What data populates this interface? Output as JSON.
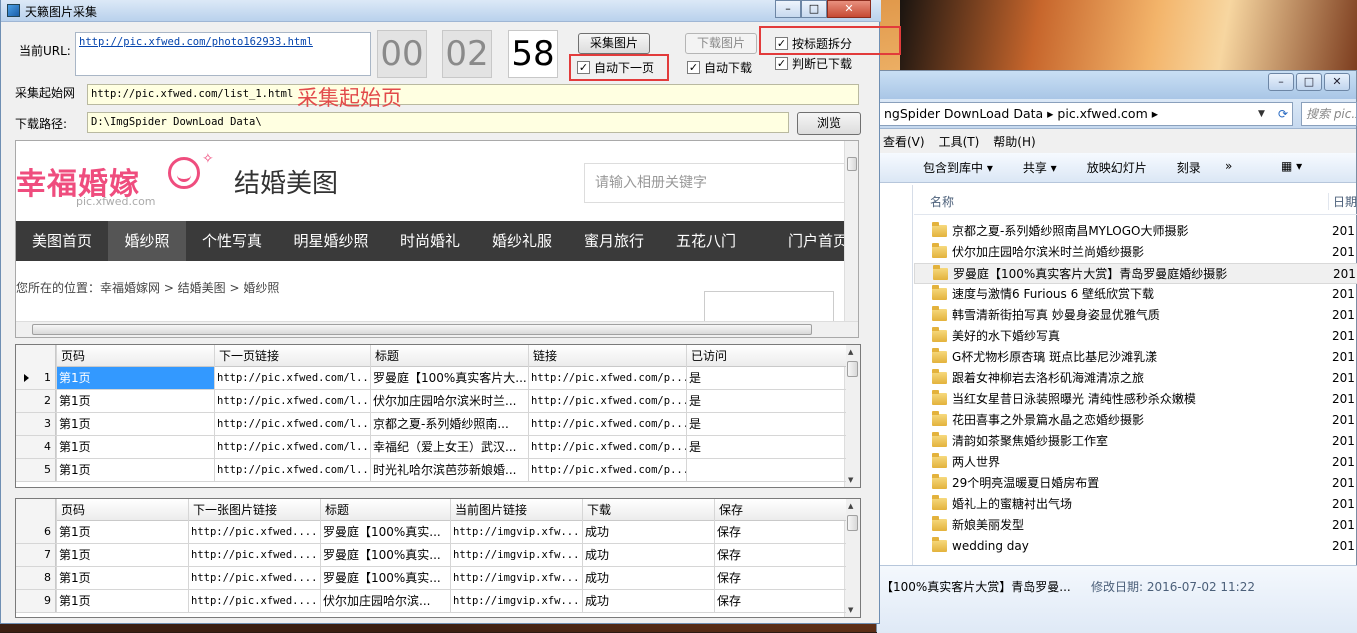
{
  "app": {
    "title": "天籁图片采集",
    "url_label": "当前URL:",
    "current_url": "http://pic.xfwed.com/photo162933.html",
    "timer": [
      "00",
      "02",
      "58"
    ],
    "collect_btn": "采集图片",
    "download_btn": "下载图片",
    "auto_next": "自动下一页",
    "auto_download": "自动下载",
    "split_by_title": "按标题拆分",
    "check_downloaded": "判断已下载",
    "start_label": "采集起始网",
    "start_url": "http://pic.xfwed.com/list_1.html",
    "annotation": "采集起始页",
    "path_label": "下载路径:",
    "download_path": "D:\\ImgSpider DownLoad Data\\",
    "browse_btn": "浏览"
  },
  "site": {
    "logo_text": "幸福婚嫁",
    "logo_sub": "pic.xfwed.com",
    "title": "结婚美图",
    "search_placeholder": "请输入相册关键字",
    "nav": [
      "美图首页",
      "婚纱照",
      "个性写真",
      "明星婚纱照",
      "时尚婚礼",
      "婚纱礼服",
      "蜜月旅行",
      "五花八门",
      "门户首页"
    ],
    "breadcrumb": "您所在的位置：幸福婚嫁网 > 结婚美图 > 婚纱照"
  },
  "grid1": {
    "headers": [
      "页码",
      "下一页链接",
      "标题",
      "链接",
      "已访问"
    ],
    "rows": [
      {
        "n": "1",
        "page": "第1页",
        "next": "http://pic.xfwed.com/l...",
        "title": "罗曼庭【100%真实客片大...",
        "link": "http://pic.xfwed.com/p...",
        "visited": "是"
      },
      {
        "n": "2",
        "page": "第1页",
        "next": "http://pic.xfwed.com/l...",
        "title": "伏尔加庄园哈尔滨米时兰...",
        "link": "http://pic.xfwed.com/p...",
        "visited": "是"
      },
      {
        "n": "3",
        "page": "第1页",
        "next": "http://pic.xfwed.com/l...",
        "title": "京都之夏-系列婚纱照南...",
        "link": "http://pic.xfwed.com/p...",
        "visited": "是"
      },
      {
        "n": "4",
        "page": "第1页",
        "next": "http://pic.xfwed.com/l...",
        "title": "幸福纪（爱上女王）武汉...",
        "link": "http://pic.xfwed.com/p...",
        "visited": "是"
      },
      {
        "n": "5",
        "page": "第1页",
        "next": "http://pic.xfwed.com/l...",
        "title": "时光礼哈尔滨芭莎新娘婚...",
        "link": "http://pic.xfwed.com/p...",
        "visited": ""
      }
    ]
  },
  "grid2": {
    "headers": [
      "页码",
      "下一张图片链接",
      "标题",
      "当前图片链接",
      "下载",
      "保存"
    ],
    "rows": [
      {
        "n": "6",
        "page": "第1页",
        "next": "http://pic.xfwed....",
        "title": "罗曼庭【100%真实...",
        "img": "http://imgvip.xfw...",
        "dl": "成功",
        "save": "保存"
      },
      {
        "n": "7",
        "page": "第1页",
        "next": "http://pic.xfwed....",
        "title": "罗曼庭【100%真实...",
        "img": "http://imgvip.xfw...",
        "dl": "成功",
        "save": "保存"
      },
      {
        "n": "8",
        "page": "第1页",
        "next": "http://pic.xfwed....",
        "title": "罗曼庭【100%真实...",
        "img": "http://imgvip.xfw...",
        "dl": "成功",
        "save": "保存"
      },
      {
        "n": "9",
        "page": "第1页",
        "next": "http://pic.xfwed....",
        "title": "伏尔加庄园哈尔滨...",
        "img": "http://imgvip.xfw...",
        "dl": "成功",
        "save": "保存"
      }
    ]
  },
  "explorer": {
    "address": [
      "ngSpider DownLoad Data",
      "pic.xfwed.com"
    ],
    "search_placeholder": "搜索 pic.xf",
    "menu": [
      "查看(V)",
      "工具(T)",
      "帮助(H)"
    ],
    "toolbar": [
      "包含到库中 ▾",
      "共享 ▾",
      "放映幻灯片",
      "刻录"
    ],
    "col_name": "名称",
    "col_date": "日期",
    "files": [
      {
        "name": "京都之夏-系列婚纱照南昌MYLOGO大师摄影",
        "date": "201"
      },
      {
        "name": "伏尔加庄园哈尔滨米时兰尚婚纱摄影",
        "date": "201"
      },
      {
        "name": "罗曼庭【100%真实客片大赏】青岛罗曼庭婚纱摄影",
        "date": "201"
      },
      {
        "name": "速度与激情6 Furious 6 壁纸欣赏下载",
        "date": "201"
      },
      {
        "name": "韩雪清新街拍写真 妙曼身姿显优雅气质",
        "date": "201"
      },
      {
        "name": "美好的水下婚纱写真",
        "date": "201"
      },
      {
        "name": "G杯尤物杉原杏璃 斑点比基尼沙滩乳漾",
        "date": "201"
      },
      {
        "name": "跟着女神柳岩去洛杉矶海滩清凉之旅",
        "date": "201"
      },
      {
        "name": "当红女星昔日泳装照曝光 清纯性感秒杀众嫩模",
        "date": "201"
      },
      {
        "name": "花田喜事之外景篇水晶之恋婚纱摄影",
        "date": "201"
      },
      {
        "name": "清韵如茶聚焦婚纱摄影工作室",
        "date": "201"
      },
      {
        "name": "两人世界",
        "date": "201"
      },
      {
        "name": "29个明亮温暖夏日婚房布置",
        "date": "201"
      },
      {
        "name": "婚礼上的蜜糖衬出气场",
        "date": "201"
      },
      {
        "name": "新娘美丽发型",
        "date": "201"
      },
      {
        "name": "wedding day",
        "date": "201"
      }
    ],
    "status_name": "【100%真实客片大赏】青岛罗曼...",
    "status_mod": "修改日期: 2016-07-02 11:22"
  }
}
